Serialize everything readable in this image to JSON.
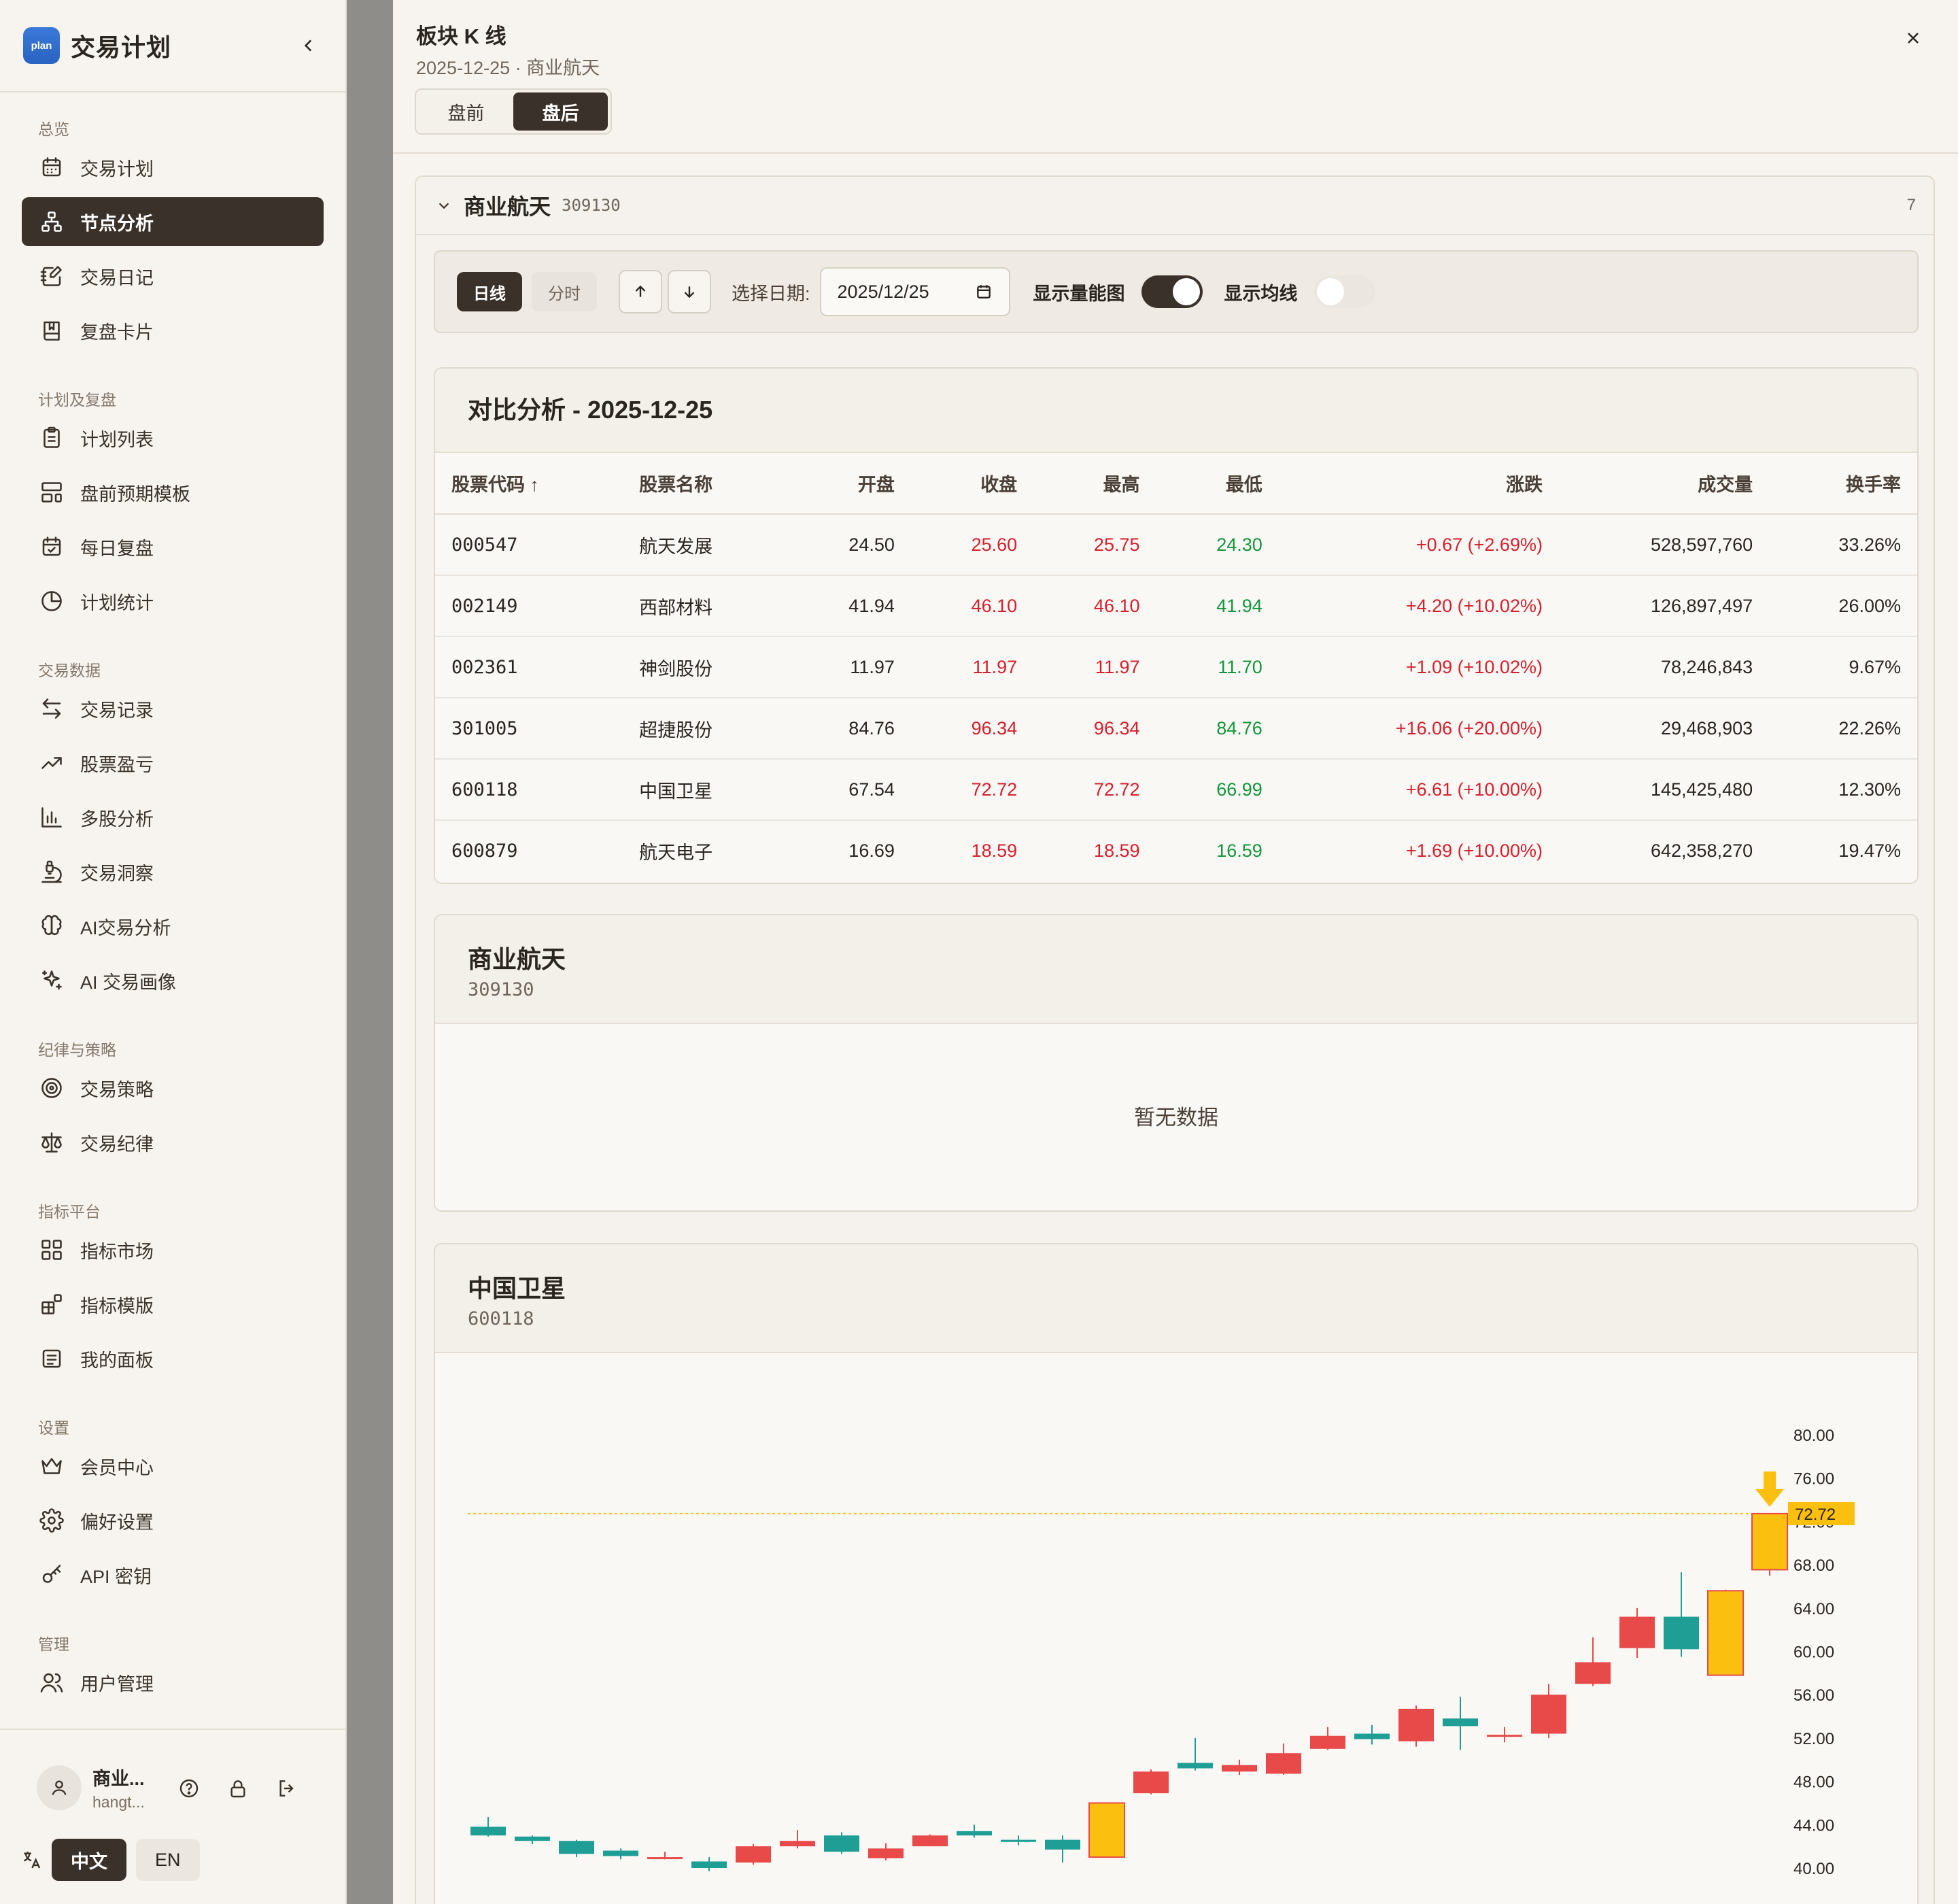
{
  "app": {
    "logo_text": "plan",
    "title": "交易计划"
  },
  "sidebar": {
    "groups": [
      {
        "label": "总览",
        "items": [
          {
            "label": "交易计划",
            "icon": "calendar-icon"
          },
          {
            "label": "节点分析",
            "icon": "network-icon",
            "active": true
          },
          {
            "label": "交易日记",
            "icon": "notebook-pen-icon"
          },
          {
            "label": "复盘卡片",
            "icon": "book-icon"
          }
        ]
      },
      {
        "label": "计划及复盘",
        "items": [
          {
            "label": "计划列表",
            "icon": "clipboard-list-icon"
          },
          {
            "label": "盘前预期模板",
            "icon": "layout-template-icon"
          },
          {
            "label": "每日复盘",
            "icon": "calendar-check-icon"
          },
          {
            "label": "计划统计",
            "icon": "pie-chart-icon"
          }
        ]
      },
      {
        "label": "交易数据",
        "items": [
          {
            "label": "交易记录",
            "icon": "arrow-left-right-icon"
          },
          {
            "label": "股票盈亏",
            "icon": "trending-up-icon"
          },
          {
            "label": "多股分析",
            "icon": "bar-chart-icon"
          },
          {
            "label": "交易洞察",
            "icon": "microscope-icon"
          },
          {
            "label": "AI交易分析",
            "icon": "brain-icon"
          },
          {
            "label": "AI 交易画像",
            "icon": "sparkles-icon"
          }
        ]
      },
      {
        "label": "纪律与策略",
        "items": [
          {
            "label": "交易策略",
            "icon": "target-icon"
          },
          {
            "label": "交易纪律",
            "icon": "scale-icon"
          }
        ]
      },
      {
        "label": "指标平台",
        "items": [
          {
            "label": "指标市场",
            "icon": "grid-icon"
          },
          {
            "label": "指标模版",
            "icon": "blocks-icon"
          },
          {
            "label": "我的面板",
            "icon": "panel-icon"
          }
        ]
      },
      {
        "label": "设置",
        "items": [
          {
            "label": "会员中心",
            "icon": "crown-icon"
          },
          {
            "label": "偏好设置",
            "icon": "gear-icon"
          },
          {
            "label": "API 密钥",
            "icon": "key-icon"
          }
        ]
      },
      {
        "label": "管理",
        "items": [
          {
            "label": "用户管理",
            "icon": "users-icon"
          }
        ]
      }
    ],
    "user": {
      "name": "商业...",
      "email": "hangt..."
    },
    "lang": {
      "zh": "中文",
      "en": "EN"
    }
  },
  "drawer": {
    "title": "板块 K 线",
    "subtitle": "2025-12-25 · 商业航天",
    "tabs": [
      "盘前",
      "盘后"
    ],
    "active_tab": "盘后"
  },
  "sector": {
    "name": "商业航天",
    "code": "309130",
    "count": "7"
  },
  "toolbar": {
    "day_btn": "日线",
    "min_btn": "分时",
    "date_label": "选择日期:",
    "date_value": "2025/12/25",
    "volume_label": "显示量能图",
    "volume_on": true,
    "ma_label": "显示均线",
    "ma_on": false
  },
  "compare": {
    "title": "对比分析 - 2025-12-25",
    "headers": [
      "股票代码 ↑",
      "股票名称",
      "开盘",
      "收盘",
      "最高",
      "最低",
      "涨跌",
      "成交量",
      "换手率"
    ],
    "rows": [
      [
        "000547",
        "航天发展",
        "24.50",
        "25.60",
        "25.75",
        "24.30",
        "+0.67 (+2.69%)",
        "528,597,760",
        "33.26%"
      ],
      [
        "002149",
        "西部材料",
        "41.94",
        "46.10",
        "46.10",
        "41.94",
        "+4.20 (+10.02%)",
        "126,897,497",
        "26.00%"
      ],
      [
        "002361",
        "神剑股份",
        "11.97",
        "11.97",
        "11.97",
        "11.70",
        "+1.09 (+10.02%)",
        "78,246,843",
        "9.67%"
      ],
      [
        "301005",
        "超捷股份",
        "84.76",
        "96.34",
        "96.34",
        "84.76",
        "+16.06 (+20.00%)",
        "29,468,903",
        "22.26%"
      ],
      [
        "600118",
        "中国卫星",
        "67.54",
        "72.72",
        "72.72",
        "66.99",
        "+6.61 (+10.00%)",
        "145,425,480",
        "12.30%"
      ],
      [
        "600879",
        "航天电子",
        "16.69",
        "18.59",
        "18.59",
        "16.59",
        "+1.69 (+10.00%)",
        "642,358,270",
        "19.47%"
      ]
    ]
  },
  "sector_card": {
    "name": "商业航天",
    "code": "309130",
    "empty": "暂无数据"
  },
  "stock_card": {
    "name": "中国卫星",
    "code": "600118"
  },
  "colors": {
    "up": "#e84a4a",
    "down": "#1f9e96",
    "highlight": "#fbbf10",
    "accent": "#3a312a"
  },
  "chart_data": {
    "type": "candlestick",
    "yticks": [
      "80.00",
      "76.00",
      "72.00",
      "68.00",
      "64.00",
      "60.00",
      "56.00",
      "52.00",
      "48.00",
      "44.00",
      "40.00"
    ],
    "ylim": [
      40,
      80
    ],
    "last_price_label": "72.72",
    "last_price": 72.72,
    "candles": [
      {
        "o": 43.8,
        "c": 43.0,
        "h": 44.7,
        "l": 42.9
      },
      {
        "o": 42.9,
        "c": 42.5,
        "h": 43.0,
        "l": 42.2
      },
      {
        "o": 42.5,
        "c": 41.3,
        "h": 42.6,
        "l": 41.0
      },
      {
        "o": 41.6,
        "c": 41.1,
        "h": 41.8,
        "l": 40.8
      },
      {
        "o": 41.0,
        "c": 41.0,
        "h": 41.5,
        "l": 40.8
      },
      {
        "o": 40.6,
        "c": 40.0,
        "h": 41.0,
        "l": 39.7
      },
      {
        "o": 40.5,
        "c": 42.0,
        "h": 42.2,
        "l": 40.3
      },
      {
        "o": 42.0,
        "c": 42.5,
        "h": 43.5,
        "l": 41.8
      },
      {
        "o": 43.0,
        "c": 41.5,
        "h": 43.3,
        "l": 41.3
      },
      {
        "o": 40.9,
        "c": 41.8,
        "h": 42.3,
        "l": 40.7
      },
      {
        "o": 42.0,
        "c": 43.0,
        "h": 43.1,
        "l": 42.0
      },
      {
        "o": 43.4,
        "c": 43.0,
        "h": 44.0,
        "l": 42.8
      },
      {
        "o": 42.6,
        "c": 42.4,
        "h": 43.0,
        "l": 42.1
      },
      {
        "o": 42.6,
        "c": 41.7,
        "h": 43.0,
        "l": 40.5
      },
      {
        "o": 41.0,
        "c": 46.0,
        "h": 46.0,
        "l": 41.0,
        "hl": true
      },
      {
        "o": 46.9,
        "c": 48.9,
        "h": 49.1,
        "l": 46.8
      },
      {
        "o": 49.7,
        "c": 49.2,
        "h": 52.0,
        "l": 49.0
      },
      {
        "o": 48.9,
        "c": 49.5,
        "h": 50.0,
        "l": 48.6
      },
      {
        "o": 48.7,
        "c": 50.6,
        "h": 51.5,
        "l": 48.6
      },
      {
        "o": 51.0,
        "c": 52.2,
        "h": 53.0,
        "l": 50.9
      },
      {
        "o": 52.4,
        "c": 51.9,
        "h": 53.2,
        "l": 51.4
      },
      {
        "o": 51.7,
        "c": 54.7,
        "h": 55.0,
        "l": 51.2
      },
      {
        "o": 53.8,
        "c": 53.1,
        "h": 55.8,
        "l": 50.9
      },
      {
        "o": 52.3,
        "c": 52.3,
        "h": 53.0,
        "l": 51.6
      },
      {
        "o": 52.4,
        "c": 56.0,
        "h": 57.0,
        "l": 52.0
      },
      {
        "o": 57.0,
        "c": 59.0,
        "h": 61.3,
        "l": 56.8
      },
      {
        "o": 60.3,
        "c": 63.2,
        "h": 64.0,
        "l": 59.4
      },
      {
        "o": 63.2,
        "c": 60.2,
        "h": 67.3,
        "l": 59.5
      },
      {
        "o": 57.8,
        "c": 65.6,
        "h": 65.7,
        "l": 57.8,
        "hl": true
      },
      {
        "o": 67.54,
        "c": 72.72,
        "h": 72.72,
        "l": 66.99,
        "hl": true
      }
    ]
  }
}
